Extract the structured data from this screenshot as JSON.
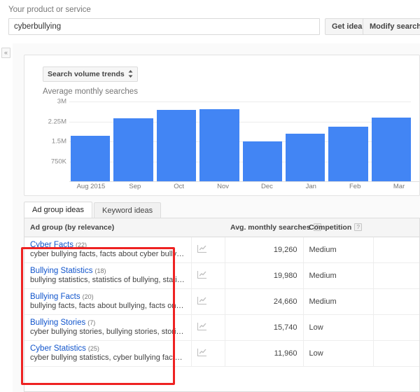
{
  "search": {
    "label": "Your product or service",
    "value": "cyberbullying",
    "placeholder": "",
    "get_ideas_label": "Get ideas",
    "modify_search_label": "Modify search"
  },
  "collapse": {
    "glyph": "«"
  },
  "chart_panel": {
    "select_label": "Search volume trends",
    "select_arrows": "↕",
    "title": "Average monthly searches"
  },
  "chart_data": {
    "type": "bar",
    "title": "Average monthly searches",
    "xlabel": "",
    "ylabel": "Average monthly searches",
    "categories": [
      "Aug 2015",
      "Sep",
      "Oct",
      "Nov",
      "Dec",
      "Jan",
      "Feb",
      "Mar"
    ],
    "values": [
      1720000,
      2360000,
      2680000,
      2710000,
      1500000,
      1800000,
      2060000,
      2390000
    ],
    "ylim": [
      0,
      3000000
    ],
    "yticks": [
      750000,
      1500000,
      2250000,
      3000000
    ],
    "ytick_labels": [
      "750K",
      "1.5M",
      "2.25M",
      "3M"
    ],
    "grid": true,
    "legend": false,
    "bar_color": "#4285f4",
    "note": "last bar (Mar) is clipped by the right edge of the screenshot"
  },
  "tabs": [
    {
      "label": "Ad group ideas",
      "active": true
    },
    {
      "label": "Keyword ideas",
      "active": false
    }
  ],
  "table": {
    "columns": [
      {
        "label": "Ad group (by relevance)",
        "help": false
      },
      {
        "label": "",
        "help": false
      },
      {
        "label": "Avg. monthly searches",
        "help": true
      },
      {
        "label": "Competition",
        "help": true
      },
      {
        "label": "",
        "help": false
      }
    ],
    "help_glyph": "?",
    "rows": [
      {
        "name": "Cyber Facts",
        "count": "(22)",
        "keywords": "cyber bullying facts, facts about cyber bullyin…",
        "avg_monthly_searches": "19,260",
        "competition": "Medium"
      },
      {
        "name": "Bullying Statistics",
        "count": "(18)",
        "keywords": "bullying statistics, statistics of bullying, statisti…",
        "avg_monthly_searches": "19,980",
        "competition": "Medium"
      },
      {
        "name": "Bullying Facts",
        "count": "(20)",
        "keywords": "bullying facts, facts about bullying, facts on b…",
        "avg_monthly_searches": "24,660",
        "competition": "Medium"
      },
      {
        "name": "Bullying Stories",
        "count": "(7)",
        "keywords": "cyber bullying stories, bullying stories, storie…",
        "avg_monthly_searches": "15,740",
        "competition": "Low"
      },
      {
        "name": "Cyber Statistics",
        "count": "(25)",
        "keywords": "cyber bullying statistics, cyber bullying facts …",
        "avg_monthly_searches": "11,960",
        "competition": "Low"
      }
    ]
  },
  "annotation": {
    "color": "#ee2222"
  }
}
